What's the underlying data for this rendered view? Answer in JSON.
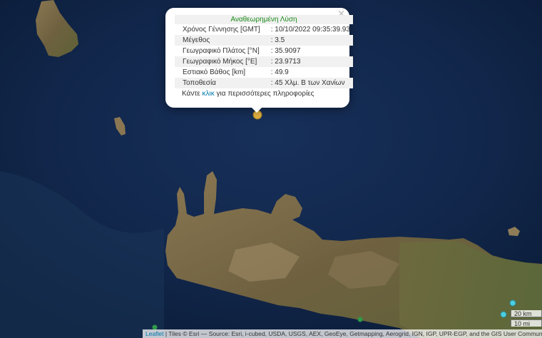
{
  "popup": {
    "title": "Αναθεωρημένη Λύση",
    "rows": [
      {
        "label": "Χρόνος Γέννησης [GMT]",
        "value": ": 10/10/2022 09:35:39.93"
      },
      {
        "label": "Μέγεθος",
        "value": ": 3.5"
      },
      {
        "label": "Γεωγραφικό Πλάτος [°N]",
        "value": ": 35.9097"
      },
      {
        "label": "Γεωγραφικό Μήκος [°E]",
        "value": ": 23.9713"
      },
      {
        "label": "Εστιακό Βάθος [km]",
        "value": ": 49.9"
      },
      {
        "label": "Τοποθεσία",
        "value": ": 45 Χλμ. Β των Χανίων"
      }
    ],
    "more_prefix": "Κάντε",
    "more_link": "κλικ",
    "more_suffix": "για περισσότερες πληροφορίες",
    "close": "×"
  },
  "scale": {
    "km": "20 km",
    "mi": "10 mi"
  },
  "attribution": {
    "leaflet": "Leaflet",
    "text": " | Tiles © Esri — Source: Esri, i-cubed, USDA, USGS, AEX, GeoEye, Getmapping, Aerogrid, IGN, IGP, UPR-EGP, and the GIS User Community"
  },
  "colors": {
    "sea": "#10233f",
    "land": "#7b6a48",
    "marker_main": "#e0b040",
    "marker_green": "#2e9a48",
    "marker_cyan": "#4ccfe0"
  }
}
